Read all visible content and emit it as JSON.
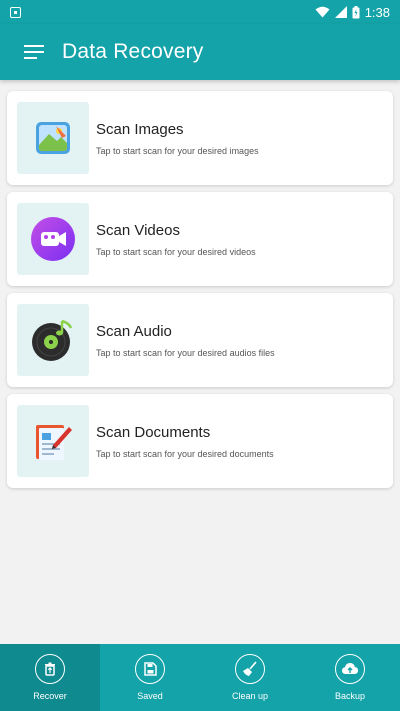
{
  "status_bar": {
    "time": "1:38"
  },
  "app_bar": {
    "title": "Data Recovery"
  },
  "cards": [
    {
      "title": "Scan Images",
      "subtitle": "Tap to start scan for your desired images",
      "icon": "image-gallery-icon"
    },
    {
      "title": "Scan Videos",
      "subtitle": "Tap to start scan for your desired videos",
      "icon": "video-camera-icon"
    },
    {
      "title": "Scan Audio",
      "subtitle": "Tap to start scan for your desired audios files",
      "icon": "music-disc-icon"
    },
    {
      "title": "Scan Documents",
      "subtitle": "Tap to start scan for your desired documents",
      "icon": "document-pen-icon"
    }
  ],
  "bottom_nav": [
    {
      "label": "Recover",
      "icon": "trash-restore-icon",
      "active": true
    },
    {
      "label": "Saved",
      "icon": "save-disk-icon",
      "active": false
    },
    {
      "label": "Clean up",
      "icon": "broom-icon",
      "active": false
    },
    {
      "label": "Backup",
      "icon": "cloud-upload-icon",
      "active": false
    }
  ],
  "colors": {
    "primary": "#13a3a8",
    "primary_dark": "#0f8a8e",
    "background": "#f2f2f2",
    "thumb_bg": "#e3f3f4"
  }
}
